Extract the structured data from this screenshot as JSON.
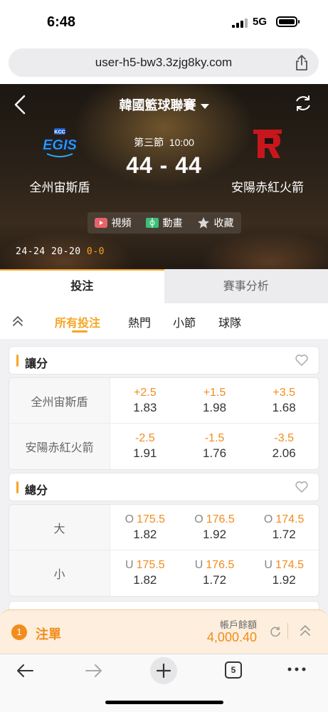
{
  "status": {
    "time": "6:48",
    "network": "5G"
  },
  "browser": {
    "url": "user-h5-bw3.3zjg8ky.com",
    "tab_count": "5"
  },
  "match": {
    "league": "韓國籃球聯賽",
    "period": "第三節",
    "clock": "10:00",
    "score": "44 - 44",
    "home": {
      "name": "全州宙斯盾",
      "logo_text": "EGIS",
      "logo_sub": "KCC"
    },
    "away": {
      "name": "安陽赤紅火箭",
      "logo_text": "R"
    },
    "quarter_scores": "24-24 20-20",
    "current_quarter_score": "0-0",
    "media": {
      "video": "視頻",
      "animation": "動畫",
      "favorite": "收藏"
    }
  },
  "main_tabs": {
    "bet": "投注",
    "analysis": "賽事分析"
  },
  "sub_tabs": {
    "all": "所有投注",
    "hot": "熱門",
    "quarter": "小節",
    "team": "球隊"
  },
  "handicap": {
    "title": "讓分",
    "rows": [
      {
        "label": "全州宙斯盾",
        "cells": [
          {
            "line": "+2.5",
            "odds": "1.83"
          },
          {
            "line": "+1.5",
            "odds": "1.98"
          },
          {
            "line": "+3.5",
            "odds": "1.68"
          }
        ]
      },
      {
        "label": "安陽赤紅火箭",
        "cells": [
          {
            "line": "-2.5",
            "odds": "1.91"
          },
          {
            "line": "-1.5",
            "odds": "1.76"
          },
          {
            "line": "-3.5",
            "odds": "2.06"
          }
        ]
      }
    ]
  },
  "total": {
    "title": "總分",
    "rows": [
      {
        "label": "大",
        "cells": [
          {
            "pre": "O",
            "line": "175.5",
            "odds": "1.82"
          },
          {
            "pre": "O",
            "line": "176.5",
            "odds": "1.92"
          },
          {
            "pre": "O",
            "line": "174.5",
            "odds": "1.72"
          }
        ]
      },
      {
        "label": "小",
        "cells": [
          {
            "pre": "U",
            "line": "175.5",
            "odds": "1.82"
          },
          {
            "pre": "U",
            "line": "176.5",
            "odds": "1.72"
          },
          {
            "pre": "U",
            "line": "174.5",
            "odds": "1.92"
          }
        ]
      }
    ]
  },
  "slip": {
    "count": "1",
    "label": "注單",
    "balance_label": "帳戶餘額",
    "balance": "4,000.40"
  },
  "colors": {
    "accent": "#f5a623",
    "odds_line": "#f28c1c"
  }
}
